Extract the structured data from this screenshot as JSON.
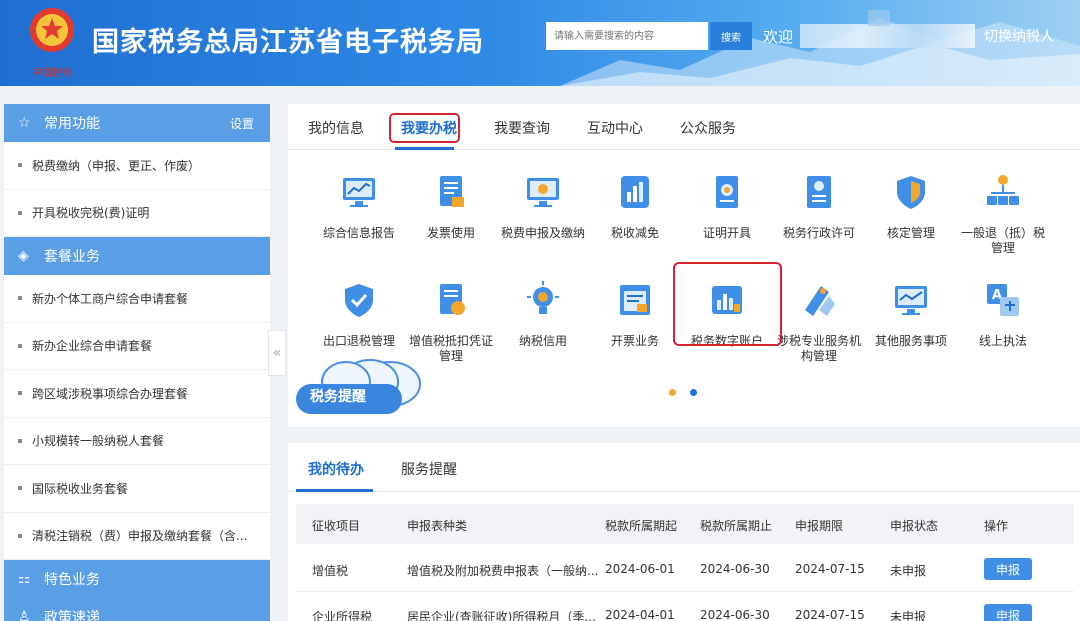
{
  "header": {
    "title": "国家税务总局江苏省电子税务局",
    "emblem_caption": "中国税务",
    "search_placeholder": "请输入需要搜索的内容",
    "search_button": "搜索",
    "welcome": "欢迎",
    "switch_taxpayer": "切换纳税人"
  },
  "sidebar": {
    "common": {
      "label": "常用功能",
      "settings": "设置",
      "icon": "star-icon"
    },
    "common_items": [
      "税费缴纳（申报、更正、作废）",
      "开具税收完税(费)证明"
    ],
    "package": {
      "label": "套餐业务",
      "icon": "layers-icon"
    },
    "package_items": [
      "新办个体工商户综合申请套餐",
      "新办企业综合申请套餐",
      "跨区域涉税事项综合办理套餐",
      "小规模转一般纳税人套餐",
      "国际税收业务套餐",
      "清税注销税（费）申报及缴纳套餐（含..."
    ],
    "special": {
      "label": "特色业务",
      "icon": "grid-icon"
    },
    "policy": {
      "label": "政策速递",
      "icon": "user-icon"
    }
  },
  "main": {
    "tabs": [
      "我的信息",
      "我要办税",
      "我要查询",
      "互动中心",
      "公众服务"
    ],
    "active_tab": "我要办税",
    "services_row1": [
      "综合信息报告",
      "发票使用",
      "税费申报及缴纳",
      "税收减免",
      "证明开具",
      "税务行政许可",
      "核定管理",
      "一般退（抵）税管理"
    ],
    "services_row2": [
      "出口退税管理",
      "增值税抵扣凭证管理",
      "纳税信用",
      "开票业务",
      "税务数字账户",
      "涉税专业服务机构管理",
      "其他服务事项",
      "线上执法"
    ],
    "reminder": "税务提醒"
  },
  "todo": {
    "tabs": [
      "我的待办",
      "服务提醒"
    ],
    "columns": [
      "征收项目",
      "申报表种类",
      "税款所属期起",
      "税款所属期止",
      "申报期限",
      "申报状态",
      "操作"
    ],
    "rows": [
      [
        "增值税",
        "增值税及附加税费申报表（一般纳...",
        "2024-06-01",
        "2024-06-30",
        "2024-07-15",
        "未申报",
        "申报"
      ],
      [
        "企业所得税",
        "居民企业(查账征收)所得税月（季...",
        "2024-04-01",
        "2024-06-30",
        "2024-07-15",
        "未申报",
        "申报"
      ]
    ]
  },
  "colors": {
    "primary": "#1e6fd0",
    "highlight": "#d4252e",
    "sidebar_head": "#5a9ee6"
  }
}
